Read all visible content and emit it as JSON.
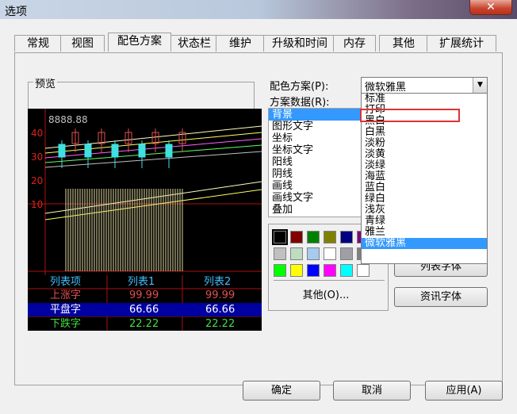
{
  "window": {
    "title": "选项",
    "close_label": "✕"
  },
  "tabs": [
    {
      "label": "常规"
    },
    {
      "label": "视图"
    },
    {
      "label": "配色方案"
    },
    {
      "label": "状态栏"
    },
    {
      "label": "维护"
    },
    {
      "label": "升级和时间"
    },
    {
      "label": "内存"
    },
    {
      "label": "其他"
    },
    {
      "label": "扩展统计"
    }
  ],
  "preview": {
    "group_label": "预览",
    "price_label": "8888.88",
    "axis_labels": [
      "40",
      "30",
      "20",
      "10"
    ],
    "table": {
      "headers": [
        "列表项",
        "列表1",
        "列表2"
      ],
      "rows": [
        [
          "上涨字",
          "99.99",
          "99.99"
        ],
        [
          "平盘字",
          "66.66",
          "66.66"
        ],
        [
          "下跌字",
          "22.22",
          "22.22"
        ]
      ]
    },
    "colors": {
      "bg": "#000000",
      "grid": "#b01010",
      "axis_text": "#e02020",
      "up": "#e05050",
      "down": "#40e040",
      "flat_bg": "#0000a0",
      "header": "#40c0ff",
      "price_text": "#c0c0c0"
    }
  },
  "scheme": {
    "scheme_label": "配色方案(P):",
    "data_label": "方案数据(R):",
    "selected": "微软雅黑",
    "options": [
      "标准",
      "打印",
      "黑白",
      "白黑",
      "淡粉",
      "淡黄",
      "淡绿",
      "海蓝",
      "蓝白",
      "绿白",
      "浅灰",
      "青绿",
      "雅兰",
      "微软雅黑"
    ],
    "items": [
      "背景",
      "图形文字",
      "坐标",
      "坐标文字",
      "阳线",
      "阴线",
      "画线",
      "画线文字",
      "叠加"
    ],
    "selected_item": "背景"
  },
  "palette": {
    "colors": [
      "#000000",
      "#800000",
      "#008000",
      "#808000",
      "#000080",
      "#800080",
      "#c0c0c0",
      "#c0dcc0",
      "#a6caf0",
      "#ffffff",
      "#a0a0a4",
      "#808080",
      "#00ff00",
      "#ffff00",
      "#0000ff",
      "#ff00ff",
      "#00ffff",
      "#ffffff"
    ],
    "other_label": "其他(O)..."
  },
  "font_buttons": {
    "list_font": "列表字体",
    "info_font": "资讯字体"
  },
  "footer": {
    "ok": "确定",
    "cancel": "取消",
    "apply": "应用(A)"
  }
}
